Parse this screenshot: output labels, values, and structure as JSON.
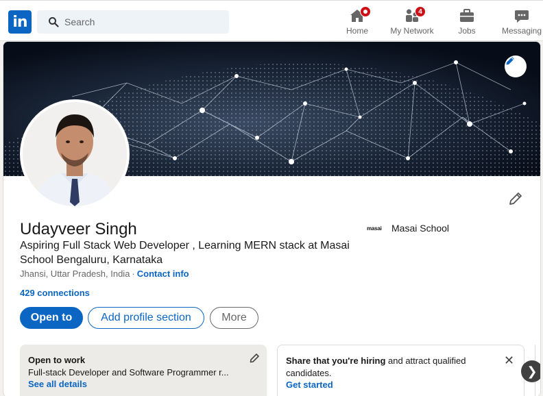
{
  "nav": {
    "logo_text": "in",
    "search_placeholder": "Search",
    "items": [
      {
        "label": "Home",
        "icon": "home-icon",
        "badge": ""
      },
      {
        "label": "My Network",
        "icon": "network-icon",
        "badge": "4"
      },
      {
        "label": "Jobs",
        "icon": "briefcase-icon",
        "badge": ""
      },
      {
        "label": "Messaging",
        "icon": "chat-icon",
        "badge": ""
      }
    ]
  },
  "profile": {
    "name": "Udayveer Singh",
    "headline": "Aspiring Full Stack Web Developer , Learning MERN stack at Masai School Bengaluru, Karnataka",
    "location": "Jhansi, Uttar Pradesh, India",
    "separator": "·",
    "contact_label": "Contact info",
    "connections": "429 connections",
    "education": {
      "logo_text": "masai",
      "name": "Masai School"
    }
  },
  "actions": {
    "open_to": "Open to",
    "add_section": "Add profile section",
    "more": "More"
  },
  "open_to_work": {
    "title": "Open to work",
    "desc": "Full-stack Developer and Software Programmer r...",
    "link": "See all details"
  },
  "hiring": {
    "text_bold": "Share that you're hiring",
    "text_rest": " and attract qualified candidates.",
    "link": "Get started",
    "close": "✕"
  },
  "carousel": {
    "next": "❯"
  },
  "colors": {
    "brand": "#0a66c2",
    "badge": "#cc1016"
  }
}
